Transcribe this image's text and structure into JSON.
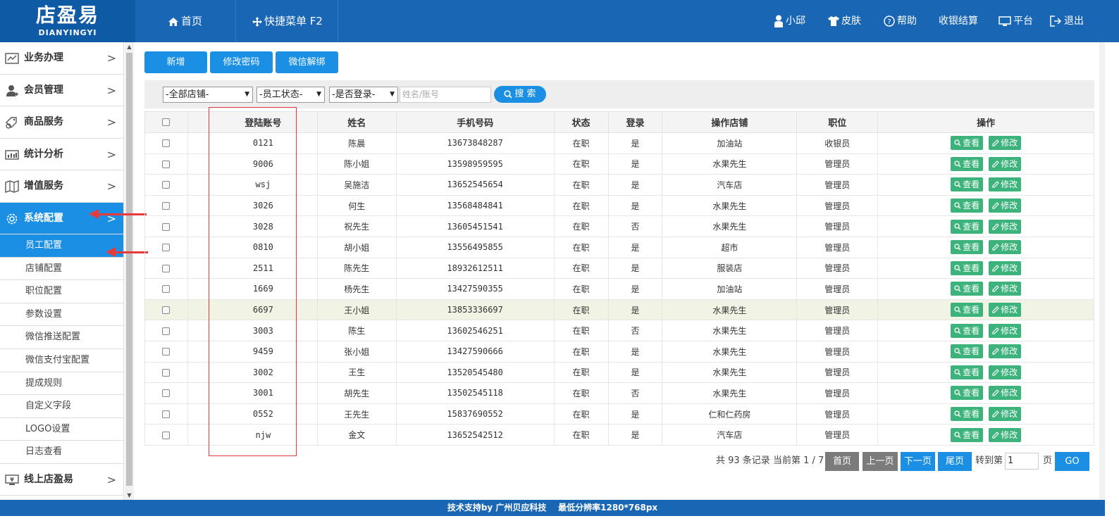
{
  "logo": {
    "cn": "店盈易",
    "en": "DIANYINGYI"
  },
  "topnav": {
    "home": "首页",
    "quick_menu": "快捷菜单 F2"
  },
  "topright": {
    "user": "小邱",
    "skin": "皮肤",
    "help": "帮助",
    "checkout": "收银结算",
    "platform": "平台",
    "logout": "退出"
  },
  "sidebar": {
    "menu": [
      {
        "label": "业务办理",
        "icon": "chart-icon"
      },
      {
        "label": "会员管理",
        "icon": "member-icon"
      },
      {
        "label": "商品服务",
        "icon": "goods-icon"
      },
      {
        "label": "统计分析",
        "icon": "stats-icon"
      },
      {
        "label": "增值服务",
        "icon": "value-icon"
      },
      {
        "label": "系统配置",
        "icon": "settings-icon",
        "active": true
      }
    ],
    "submenu": [
      "员工配置",
      "店铺配置",
      "职位配置",
      "参数设置",
      "微信推送配置",
      "微信支付宝配置",
      "提成规则",
      "自定义字段",
      "LOGO设置",
      "日志查看"
    ],
    "bottom": {
      "label": "线上店盈易",
      "icon": "online-icon"
    }
  },
  "toolbar": {
    "add": "新增",
    "change_pwd": "修改密码",
    "wechat_unbind": "微信解绑"
  },
  "filters": {
    "store": "-全部店铺-",
    "status": "-员工状态-",
    "login": "-是否登录-",
    "name_placeholder": "姓名/账号",
    "search": "搜 索"
  },
  "table": {
    "headers": [
      "登陆账号",
      "姓名",
      "手机号码",
      "状态",
      "登录",
      "操作店铺",
      "职位",
      "操作"
    ],
    "view_label": "查看",
    "edit_label": "修改",
    "rows": [
      [
        "0121",
        "陈晨",
        "13673848287",
        "在职",
        "是",
        "加油站",
        "收银员"
      ],
      [
        "9006",
        "陈小姐",
        "13598959595",
        "在职",
        "是",
        "水果先生",
        "管理员"
      ],
      [
        "wsj",
        "吴施洁",
        "13652545654",
        "在职",
        "是",
        "汽车店",
        "管理员"
      ],
      [
        "3026",
        "何生",
        "13568484841",
        "在职",
        "是",
        "水果先生",
        "管理员"
      ],
      [
        "3028",
        "祝先生",
        "13605451541",
        "在职",
        "否",
        "水果先生",
        "管理员"
      ],
      [
        "0810",
        "胡小姐",
        "13556495855",
        "在职",
        "是",
        "超市",
        "管理员"
      ],
      [
        "2511",
        "陈先生",
        "18932612511",
        "在职",
        "是",
        "服装店",
        "管理员"
      ],
      [
        "1669",
        "杨先生",
        "13427590355",
        "在职",
        "是",
        "加油站",
        "管理员"
      ],
      [
        "6697",
        "王小姐",
        "13853336697",
        "在职",
        "是",
        "水果先生",
        "管理员"
      ],
      [
        "3003",
        "陈生",
        "13602546251",
        "在职",
        "否",
        "水果先生",
        "管理员"
      ],
      [
        "9459",
        "张小姐",
        "13427590666",
        "在职",
        "是",
        "水果先生",
        "管理员"
      ],
      [
        "3002",
        "王生",
        "13520545480",
        "在职",
        "是",
        "水果先生",
        "管理员"
      ],
      [
        "3001",
        "胡先生",
        "13502545118",
        "在职",
        "否",
        "水果先生",
        "管理员"
      ],
      [
        "0552",
        "王先生",
        "15837690552",
        "在职",
        "是",
        "仁和仁药房",
        "管理员"
      ],
      [
        "njw",
        "金文",
        "13652542512",
        "在职",
        "是",
        "汽车店",
        "管理员"
      ]
    ]
  },
  "pager": {
    "summary": "共 93 条记录 当前第 1 / 7",
    "first": "首页",
    "prev": "上一页",
    "next": "下一页",
    "last": "尾页",
    "goto": "转到第",
    "page_value": "1",
    "page_unit": "页",
    "go": "GO"
  },
  "footer": {
    "text": "技术支持by 广州贝应科技    最低分辨率1280*768px"
  },
  "colors": {
    "primary": "#1866b4",
    "accent": "#1a8fe3",
    "action": "#3bb37b",
    "annotation": "#e03a3a"
  }
}
